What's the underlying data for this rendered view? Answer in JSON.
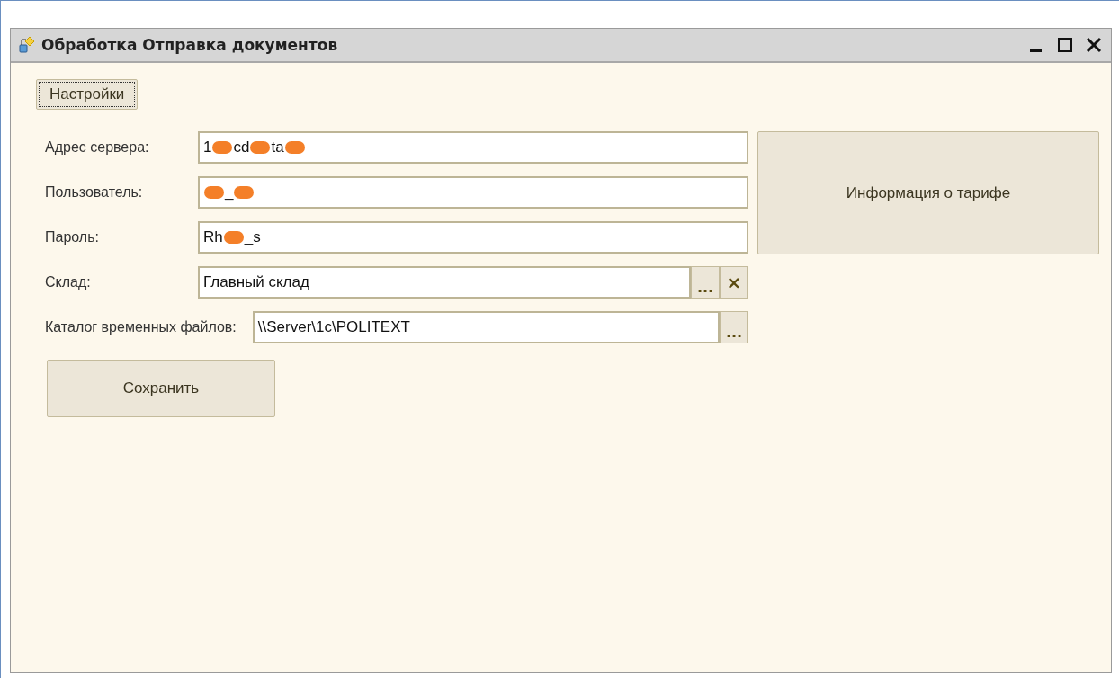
{
  "window": {
    "title": "Обработка  Отправка документов"
  },
  "settings_button": {
    "label": "Настройки",
    "focused": true
  },
  "fields": [
    {
      "label": "Адрес сервера:",
      "segments": [
        {
          "kind": "text",
          "text": "1"
        },
        {
          "kind": "redaction"
        },
        {
          "kind": "text",
          "text": "cd"
        },
        {
          "kind": "redaction"
        },
        {
          "kind": "text",
          "text": "ta"
        },
        {
          "kind": "redaction"
        }
      ]
    },
    {
      "label": "Пользователь:",
      "segments": [
        {
          "kind": "redaction"
        },
        {
          "kind": "text",
          "text": "_"
        },
        {
          "kind": "redaction"
        }
      ]
    },
    {
      "label": "Пароль:",
      "segments": [
        {
          "kind": "text",
          "text": "Rh"
        },
        {
          "kind": "redaction"
        },
        {
          "kind": "text",
          "text": "_s"
        }
      ]
    },
    {
      "label": "Склад:",
      "segments": [
        {
          "kind": "text",
          "text": "Главный склад"
        }
      ],
      "buttons": [
        {
          "kind": "choose",
          "label": "..."
        },
        {
          "kind": "clear",
          "label": "×"
        }
      ]
    }
  ],
  "catalog_field": {
    "label": "Каталог временных файлов:",
    "value": "\\\\Server\\1c\\POLITEXT",
    "buttons": [
      {
        "kind": "choose",
        "label": "..."
      }
    ]
  },
  "save_button": {
    "label": "Сохранить"
  },
  "info_button": {
    "label": "Информация о тарифе"
  }
}
